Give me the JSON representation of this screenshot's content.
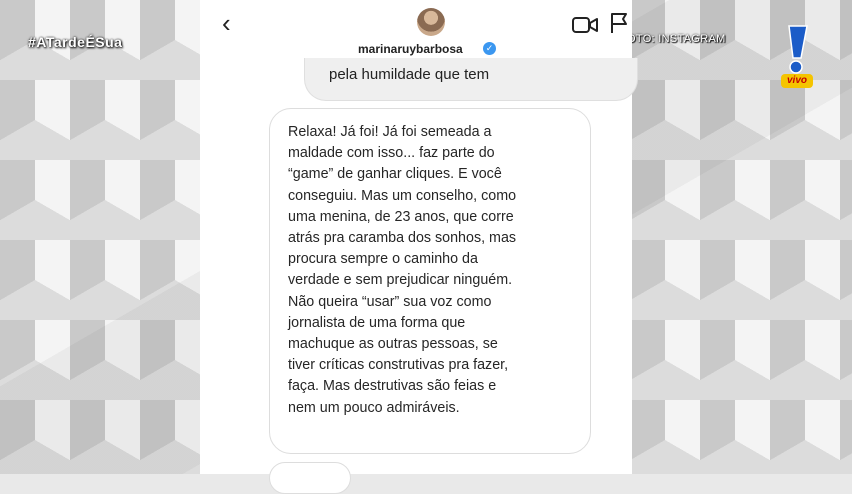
{
  "overlay": {
    "hashtag": "#ATardeÉSua",
    "credit": "FOTO: INSTAGRAM",
    "live_label": "vivo"
  },
  "header": {
    "back_icon": "chevron-left-icon",
    "username": "marinaruybarbosa",
    "verified_icon": "verified-badge-icon",
    "actions": [
      "video-call-icon",
      "flag-icon"
    ]
  },
  "messages": [
    {
      "text": "pela humildade que tem"
    },
    {
      "text": "Relaxa! Já foi! Já foi semeada a\nmaldade com isso... faz parte do\n“game” de ganhar cliques. E você\nconseguiu. Mas um conselho, como\numa menina, de 23 anos, que corre\natrás pra caramba dos sonhos, mas\nprocura sempre o caminho da\nverdade e sem prejudicar ninguém.\nNão queira “usar” sua voz como\njornalista de uma forma que\nmachuque as outras pessoas, se\ntiver críticas construtivas pra fazer,\nfaça. Mas destrutivas são feias e\nnem um pouco admiráveis."
    }
  ],
  "colors": {
    "verified": "#3b97f0",
    "logo_yellow": "#f5c400",
    "logo_blue": "#1b5cc8"
  }
}
